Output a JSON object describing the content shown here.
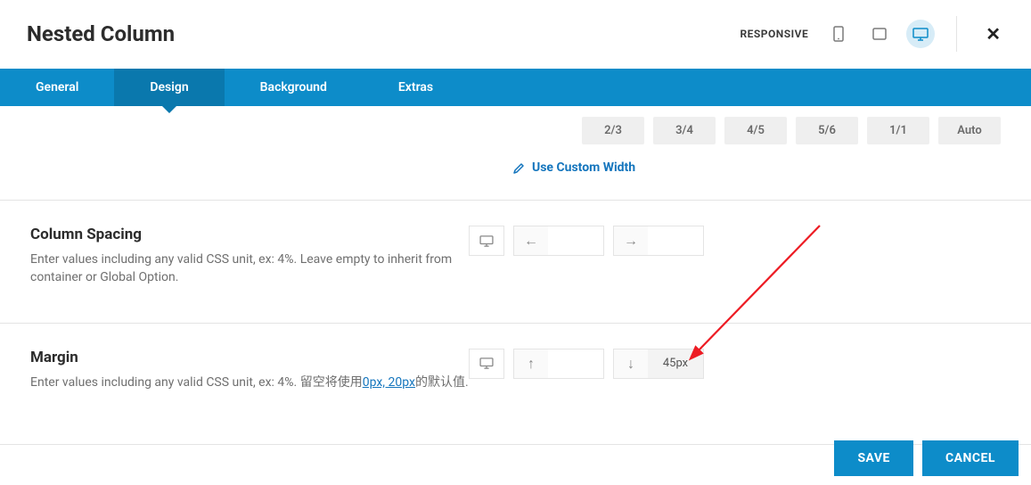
{
  "header": {
    "title": "Nested Column",
    "responsive_label": "RESPONSIVE"
  },
  "tabs": {
    "general": "General",
    "design": "Design",
    "background": "Background",
    "extras": "Extras"
  },
  "width": {
    "options": [
      "2/3",
      "3/4",
      "4/5",
      "5/6",
      "1/1",
      "Auto"
    ],
    "custom_link": "Use Custom Width"
  },
  "spacing": {
    "title": "Column Spacing",
    "desc": "Enter values including any valid CSS unit, ex: 4%. Leave empty to inherit from container or Global Option.",
    "left_value": "",
    "right_value": ""
  },
  "margin": {
    "title": "Margin",
    "desc_pre": "Enter values including any valid CSS unit, ex: 4%. 留空将使用",
    "desc_link": "0px, 20px",
    "desc_post": "的默认值.",
    "top_value": "",
    "bottom_value": "45px"
  },
  "footer": {
    "save": "SAVE",
    "cancel": "CANCEL"
  }
}
